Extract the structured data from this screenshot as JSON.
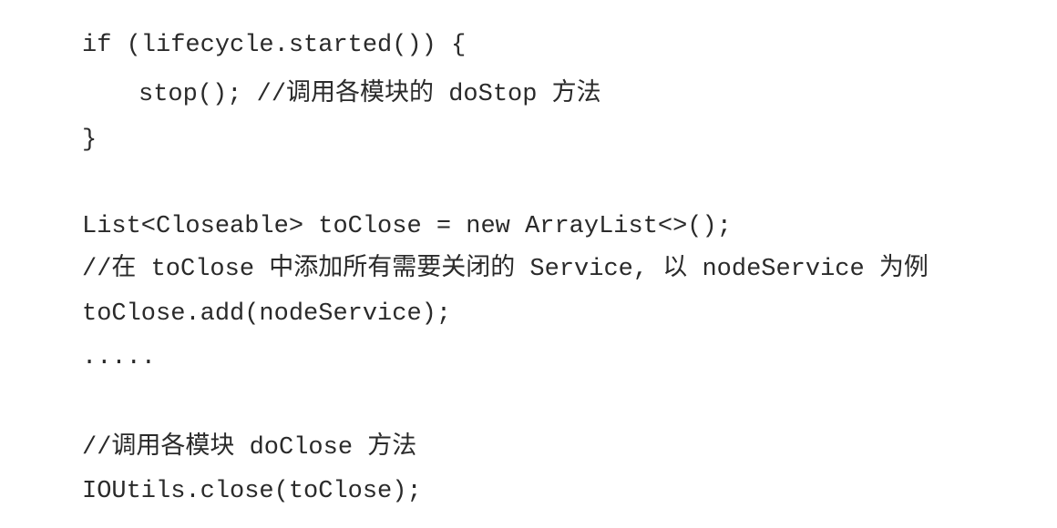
{
  "code": {
    "lines": [
      "if (lifecycle.started()) {",
      "stop(); //调用各模块的 doStop 方法",
      "}",
      "",
      "List<Closeable> toClose = new ArrayList<>();",
      "//在 toClose 中添加所有需要关闭的 Service, 以 nodeService 为例",
      "toClose.add(nodeService);",
      ".....",
      "",
      "//调用各模块 doClose 方法",
      "IOUtils.close(toClose);"
    ]
  }
}
